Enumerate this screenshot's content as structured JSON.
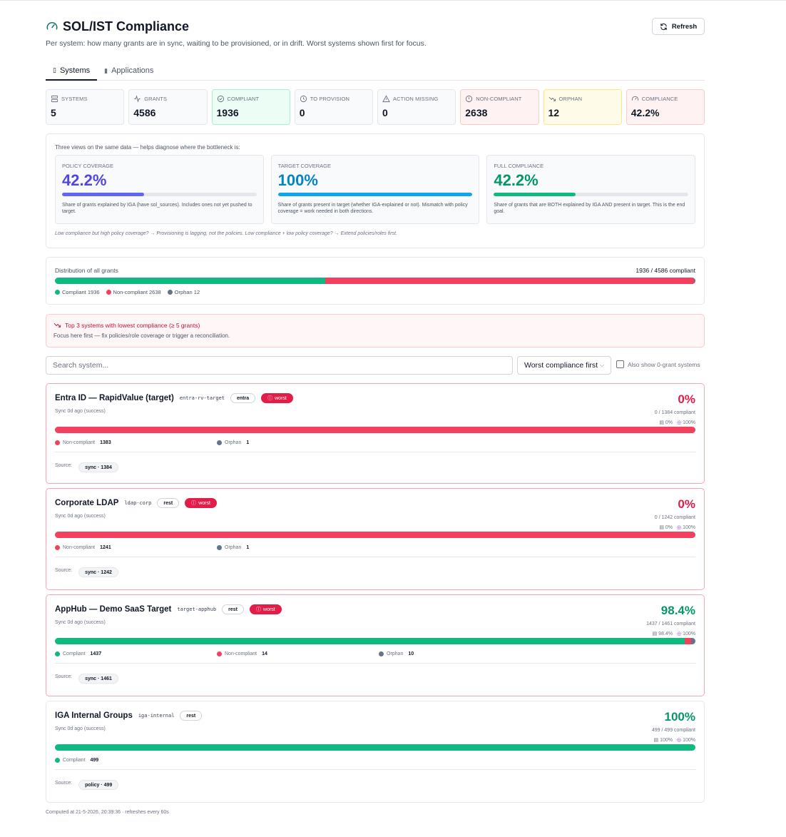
{
  "header": {
    "title": "SOL/IST Compliance",
    "subtitle": "Per system: how many grants are in sync, waiting to be provisioned, or in drift. Worst systems shown first for focus.",
    "refresh_label": "Refresh"
  },
  "tabs": [
    {
      "label": "Systems",
      "icon": "server-icon",
      "active": true
    },
    {
      "label": "Applications",
      "icon": "book-icon",
      "active": false
    }
  ],
  "stats": [
    {
      "label": "SYSTEMS",
      "value": "5",
      "icon": "server-icon"
    },
    {
      "label": "GRANTS",
      "value": "4586",
      "icon": "activity-icon"
    },
    {
      "label": "COMPLIANT",
      "value": "1936",
      "icon": "check-circle-icon"
    },
    {
      "label": "TO PROVISION",
      "value": "0",
      "icon": "clock-icon"
    },
    {
      "label": "ACTION MISSING",
      "value": "0",
      "icon": "alert-triangle-icon"
    },
    {
      "label": "NON-COMPLIANT",
      "value": "2638",
      "icon": "alert-circle-icon"
    },
    {
      "label": "ORPHAN",
      "value": "12",
      "icon": "trending-down-icon"
    },
    {
      "label": "COMPLIANCE",
      "value": "42.2%",
      "icon": "gauge-icon"
    }
  ],
  "views": {
    "intro": "Three views on the same data — helps diagnose where the bottleneck is:",
    "cards": [
      {
        "label": "POLICY COVERAGE",
        "value": "42.2%",
        "fill": 0.422,
        "color": "#4f46e5",
        "bar_color": "#6366f1",
        "desc": "Share of grants explained by IGA (have sol_sources). Includes ones not yet pushed to target."
      },
      {
        "label": "TARGET COVERAGE",
        "value": "100%",
        "fill": 1.0,
        "color": "#0284c7",
        "bar_color": "#0ea5e9",
        "desc": "Share of grants present in target (whether IGA-explained or not). Mismatch with policy coverage = work needed in both directions."
      },
      {
        "label": "FULL COMPLIANCE",
        "value": "42.2%",
        "fill": 0.422,
        "color": "#059669",
        "bar_color": "#10b981",
        "desc": "Share of grants that are BOTH explained by IGA AND present in target. This is the end goal."
      }
    ],
    "hint": "Low compliance but high policy coverage? → Provisioning is lagging, not the policies. Low compliance + low policy coverage? → Extend policies/roles first."
  },
  "distribution": {
    "title": "Distribution of all grants",
    "summary": "1936 / 4586 compliant",
    "compliant": 1936,
    "non_compliant": 2638,
    "orphan": 12,
    "total": 4586,
    "legend": [
      "Compliant 1936",
      "Non-compliant 2638",
      "Orphan 12"
    ]
  },
  "warning": {
    "title": "Top 3 systems with lowest compliance (≥ 5 grants)",
    "text": "Focus here first — fix policies/role coverage or trigger a reconciliation."
  },
  "controls": {
    "search_placeholder": "Search system...",
    "sort_value": "Worst compliance first",
    "show_zero_label": "Also show 0-grant systems"
  },
  "colors": {
    "compliant": "#10b981",
    "non_compliant": "#f43f5e",
    "orphan": "#64748b",
    "danger": "#e11d48",
    "success": "#059669"
  },
  "systems": [
    {
      "name": "Entra ID — RapidValue (target)",
      "code": "entra-rv-target",
      "type": "entra",
      "worst": true,
      "worst_label": "worst",
      "sync": "Sync 0d ago (success)",
      "pct": "0%",
      "compliant_text": "0 / 1384 compliant",
      "policy_pct": "0%",
      "target_pct": "100%",
      "compliant": 0,
      "non_compliant": 1383,
      "orphan": 1,
      "total": 1384,
      "legend": [
        {
          "label": "Non-compliant",
          "value": "1383",
          "kind": "non_compliant"
        },
        {
          "label": "Orphan",
          "value": "1",
          "kind": "orphan"
        }
      ],
      "source_label": "Source:",
      "sources": [
        "sync · 1384"
      ]
    },
    {
      "name": "Corporate LDAP",
      "code": "ldap-corp",
      "type": "rest",
      "worst": true,
      "worst_label": "worst",
      "sync": "Sync 0d ago (success)",
      "pct": "0%",
      "compliant_text": "0 / 1242 compliant",
      "policy_pct": "0%",
      "target_pct": "100%",
      "compliant": 0,
      "non_compliant": 1241,
      "orphan": 1,
      "total": 1242,
      "legend": [
        {
          "label": "Non-compliant",
          "value": "1241",
          "kind": "non_compliant"
        },
        {
          "label": "Orphan",
          "value": "1",
          "kind": "orphan"
        }
      ],
      "source_label": "Source:",
      "sources": [
        "sync · 1242"
      ]
    },
    {
      "name": "AppHub — Demo SaaS Target",
      "code": "target-apphub",
      "type": "rest",
      "worst": true,
      "worst_label": "worst",
      "sync": "Sync 0d ago (success)",
      "pct": "98.4%",
      "compliant_text": "1437 / 1461 compliant",
      "policy_pct": "98.4%",
      "target_pct": "100%",
      "compliant": 1437,
      "non_compliant": 14,
      "orphan": 10,
      "total": 1461,
      "legend": [
        {
          "label": "Compliant",
          "value": "1437",
          "kind": "compliant"
        },
        {
          "label": "Non-compliant",
          "value": "14",
          "kind": "non_compliant"
        },
        {
          "label": "Orphan",
          "value": "10",
          "kind": "orphan"
        }
      ],
      "source_label": "Source:",
      "sources": [
        "sync · 1461"
      ]
    },
    {
      "name": "IGA Internal Groups",
      "code": "iga-internal",
      "type": "rest",
      "worst": false,
      "worst_label": "",
      "sync": "Sync 0d ago (success)",
      "pct": "100%",
      "compliant_text": "499 / 499 compliant",
      "policy_pct": "100%",
      "target_pct": "100%",
      "compliant": 499,
      "non_compliant": 0,
      "orphan": 0,
      "total": 499,
      "legend": [
        {
          "label": "Compliant",
          "value": "499",
          "kind": "compliant"
        }
      ],
      "source_label": "Source:",
      "sources": [
        "policy · 499"
      ]
    }
  ],
  "footer": "Computed at 21-5-2026, 20:39:36 · refreshes every 60s"
}
